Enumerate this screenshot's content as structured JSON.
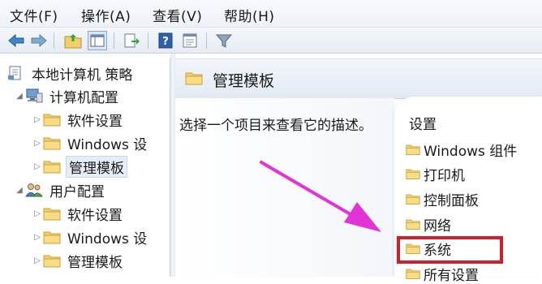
{
  "menu": [
    "文件(F)",
    "操作(A)",
    "查看(V)",
    "帮助(H)"
  ],
  "toolbar_icons": [
    "back-arrow-icon",
    "forward-arrow-icon",
    "up-folder-icon",
    "console-tree-icon",
    "export-list-icon",
    "help-icon",
    "properties-icon",
    "filter-icon"
  ],
  "tree": {
    "root": "本地计算机 策略",
    "computer_config": "计算机配置",
    "computer_children": [
      "软件设置",
      "Windows 设",
      "管理模板"
    ],
    "user_config": "用户配置",
    "user_children": [
      "软件设置",
      "Windows 设",
      "管理模板"
    ]
  },
  "right": {
    "title": "管理模板",
    "description": "选择一个项目来查看它的描述。",
    "list_header": "设置",
    "items": [
      "Windows 组件",
      "打印机",
      "控制面板",
      "网络",
      "系统",
      "所有设置"
    ]
  },
  "colors": {
    "arrow": "#e234d6",
    "highlight": "#cf1f2a",
    "folder": "#f2c65a"
  }
}
